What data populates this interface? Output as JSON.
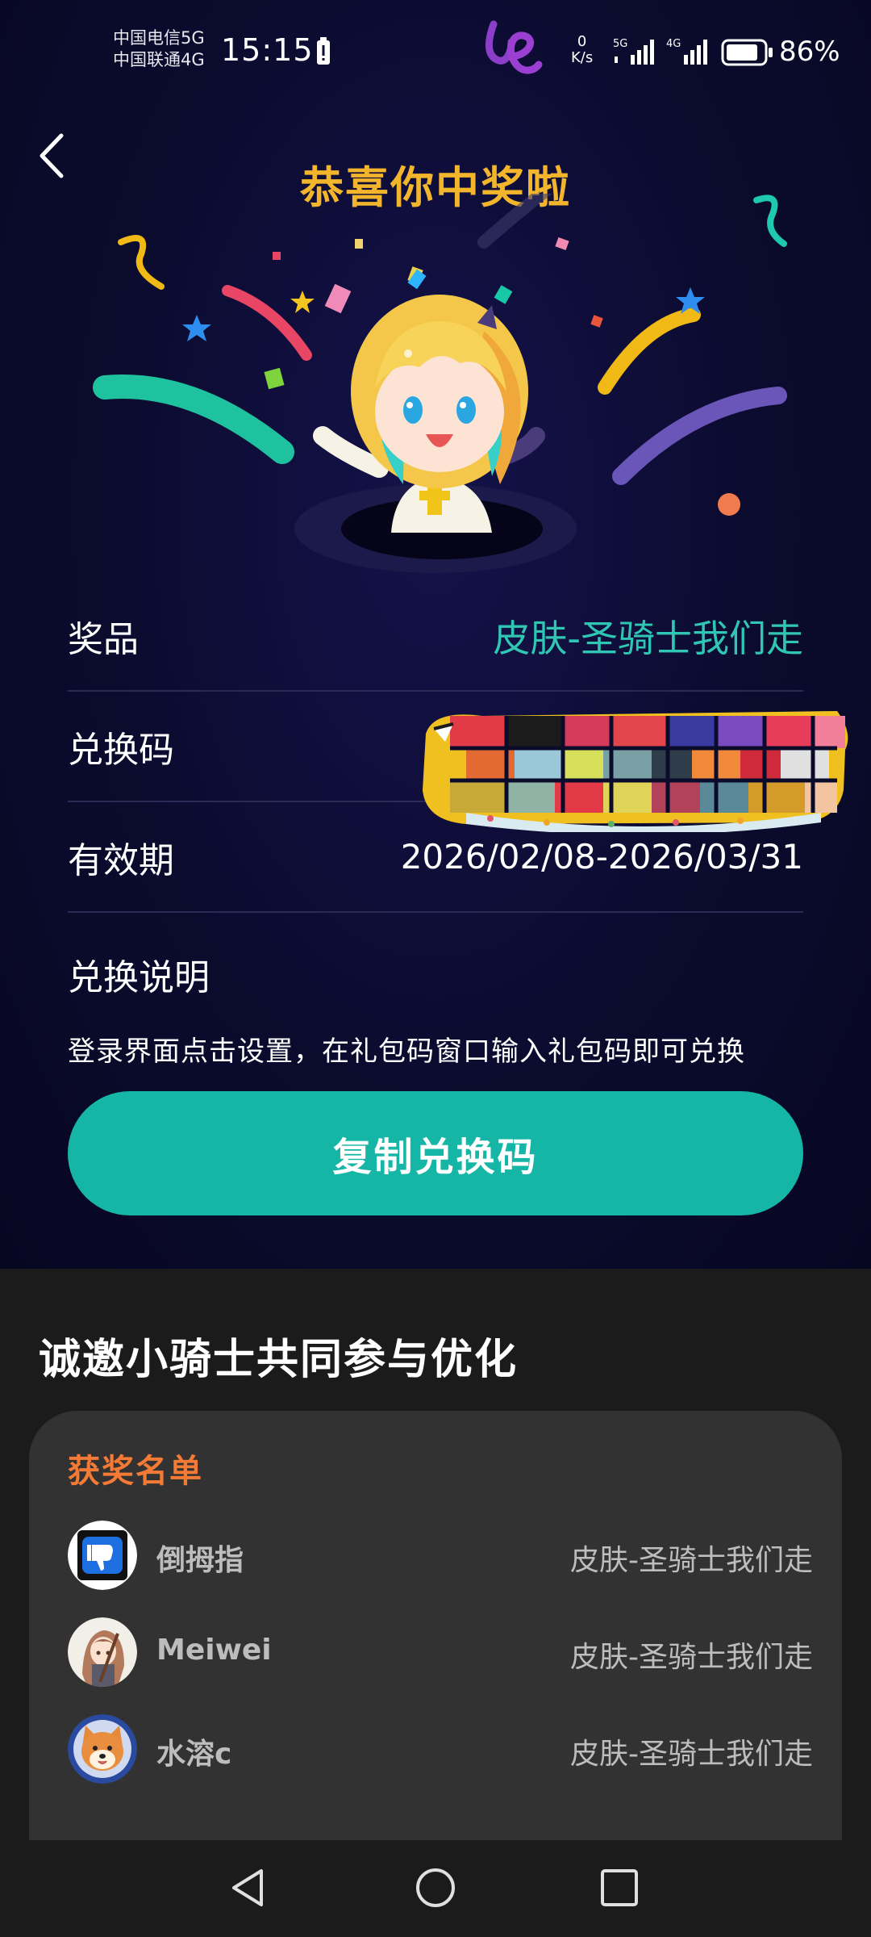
{
  "status_bar": {
    "carrier_1": "中国电信5G",
    "carrier_2": "中国联通4G",
    "time": "15:15",
    "net_speed_value": "0",
    "net_speed_unit": "K/s",
    "signal_1_label": "5G",
    "signal_2_label": "4G",
    "battery_percent": "86%",
    "battery_level": 0.86
  },
  "header": {
    "back_icon": "chevron-left-icon",
    "title": "恭喜你中奖啦"
  },
  "prize_info": {
    "prize_label": "奖品",
    "prize_value": "皮肤-圣骑士我们走",
    "code_label": "兑换码",
    "validity_label": "有效期",
    "validity_value": "2026/02/08-2026/03/31",
    "instructions_title": "兑换说明",
    "instructions_text": "登录界面点击设置，在礼包码窗口输入礼包码即可兑换"
  },
  "actions": {
    "copy_code_label": "复制兑换码"
  },
  "invite": {
    "heading": "诚邀小骑士共同参与优化"
  },
  "winners": {
    "title": "获奖名单",
    "items": [
      {
        "name": "倒拇指",
        "prize": "皮肤-圣骑士我们走",
        "avatar_icon": "thumbs-down-avatar"
      },
      {
        "name": "Meiwei",
        "prize": "皮肤-圣骑士我们走",
        "avatar_icon": "anime-girl-avatar"
      },
      {
        "name": "水溶c",
        "prize": "皮肤-圣骑士我们走",
        "avatar_icon": "shiba-dog-avatar"
      }
    ]
  },
  "nav_bar": {
    "back_icon": "triangle-back-icon",
    "home_icon": "circle-home-icon",
    "recents_icon": "square-recents-icon"
  },
  "colors": {
    "background_top": "#0b0b2c",
    "title_gold": "#f3b52c",
    "prize_teal": "#2fc6b3",
    "button_teal": "#16b6a6",
    "winners_title_orange": "#f57a36",
    "background_bottom": "#1b1b1b",
    "card_bg": "#323232"
  }
}
